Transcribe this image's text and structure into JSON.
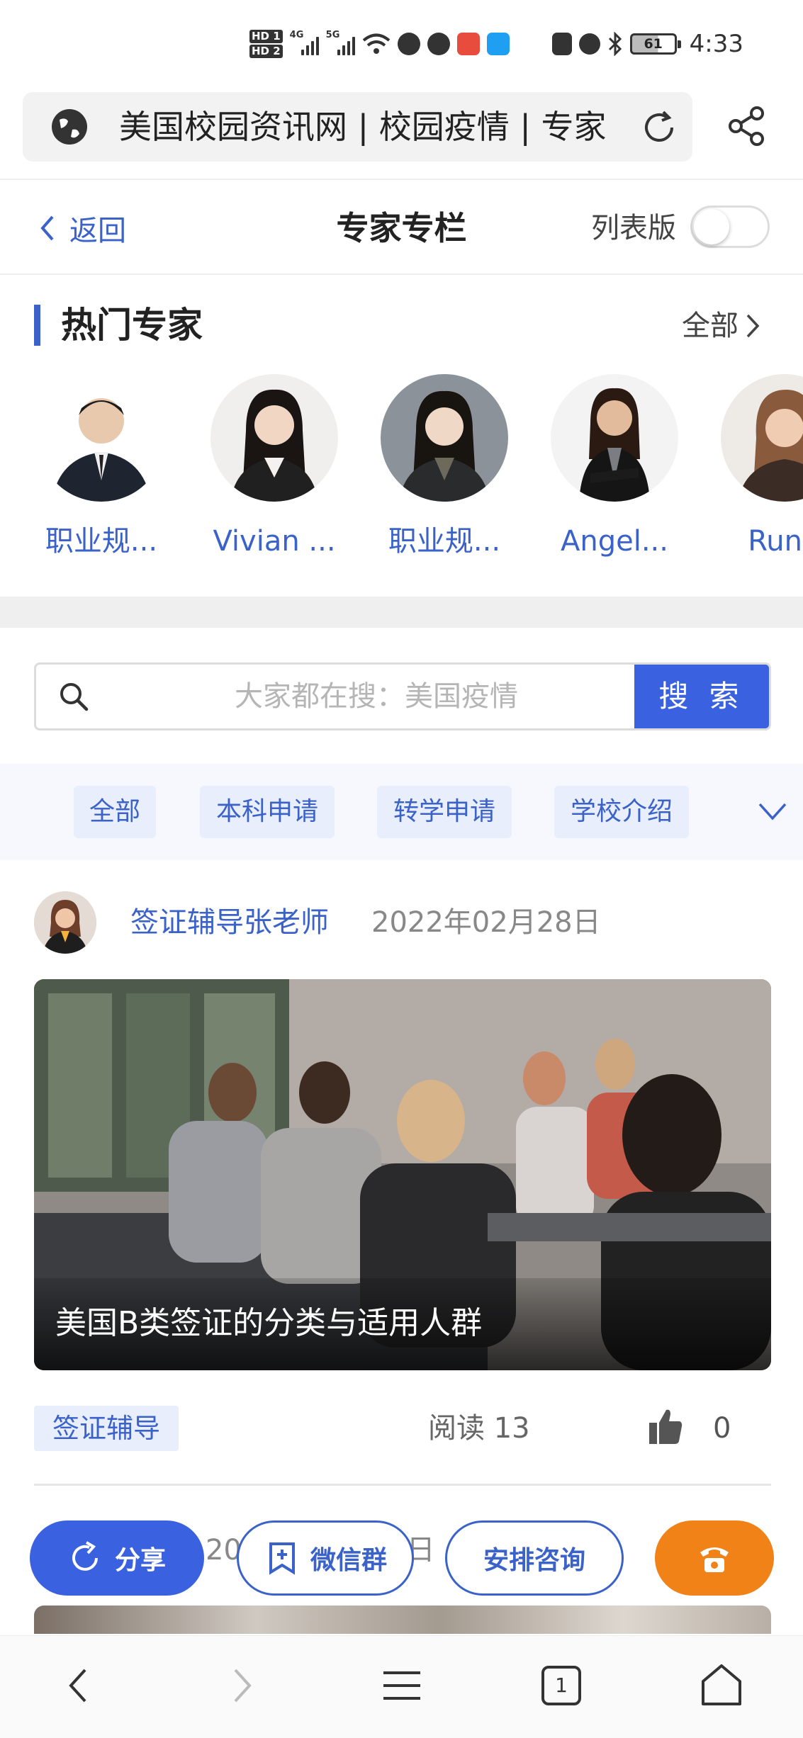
{
  "status_bar": {
    "hd1": "HD 1",
    "hd2": "HD 2",
    "net1": "4G",
    "net2": "5G",
    "battery": "61",
    "time": "4:33"
  },
  "browser": {
    "address_text": "美国校园资讯网 | 校园疫情 | 专家"
  },
  "header": {
    "back_label": "返回",
    "title": "专家专栏",
    "list_mode_label": "列表版"
  },
  "hot_experts": {
    "title": "热门专家",
    "all_label": "全部",
    "experts": [
      {
        "name": "职业规..."
      },
      {
        "name": "Vivian ..."
      },
      {
        "name": "职业规..."
      },
      {
        "name": "Angel..."
      },
      {
        "name": "Runti"
      }
    ]
  },
  "search": {
    "placeholder": "大家都在搜：美国疫情",
    "button_label": "搜 索"
  },
  "categories": [
    "全部",
    "本科申请",
    "转学申请",
    "学校介绍"
  ],
  "article": {
    "author": "签证辅导张老师",
    "date": "2022年02月28日",
    "caption": "美国B类签证的分类与适用人群",
    "tag": "签证辅导",
    "read_label": "阅读",
    "read_count": "13",
    "like_count": "0"
  },
  "next_article": {
    "date_partial": "2022年02月28日"
  },
  "actions": {
    "share": "分享",
    "wechat": "微信群",
    "consult": "安排咨询"
  },
  "browser_nav": {
    "tab_count": "1"
  },
  "colors": {
    "accent": "#3a62c9",
    "button_blue": "#3a62e0",
    "phone_orange": "#f08218",
    "tab_bg": "#e8eefb"
  }
}
